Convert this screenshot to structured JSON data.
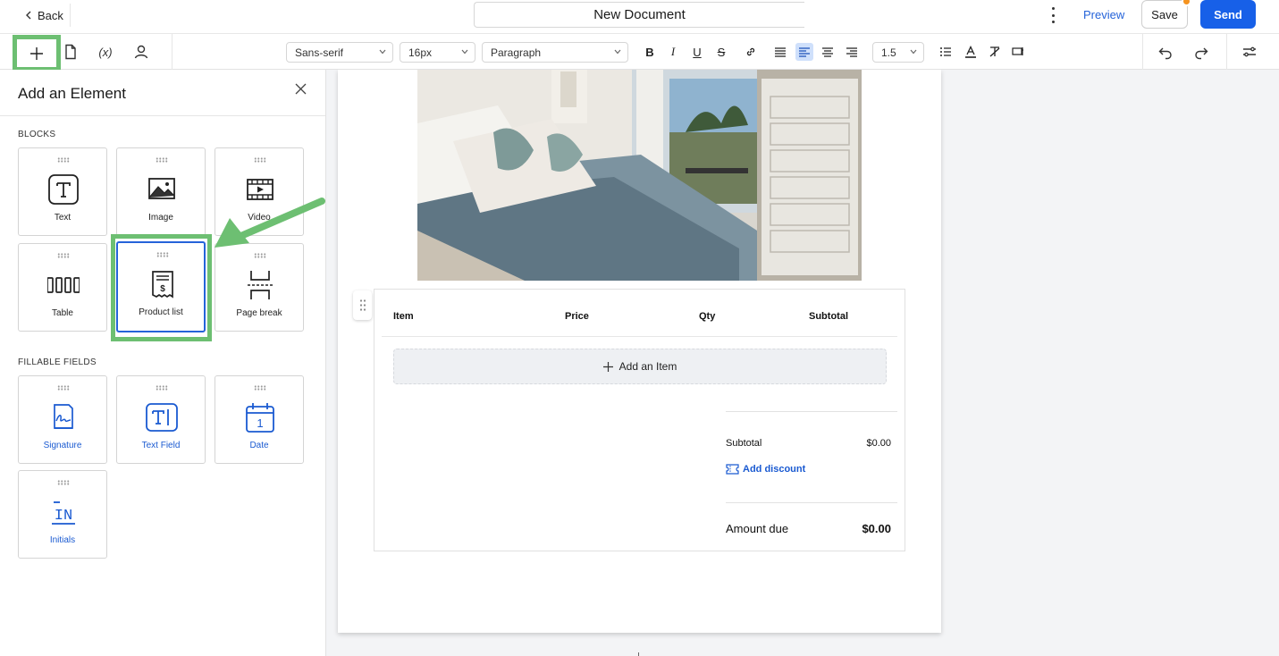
{
  "topbar": {
    "back_label": "Back",
    "document_title": "New Document",
    "preview_label": "Preview",
    "save_label": "Save",
    "send_label": "Send",
    "accent_color": "#1760e8",
    "unsaved_dot_color": "#f5931f"
  },
  "toolbar": {
    "left_icons": [
      "plus-icon",
      "document-icon",
      "variable-icon",
      "user-icon"
    ],
    "variable_glyph": "(x)",
    "font_family": "Sans-serif",
    "font_size": "16px",
    "block_style": "Paragraph",
    "line_height": "1.5",
    "format_icons": [
      "bold-icon",
      "italic-icon",
      "underline-icon",
      "strikethrough-icon",
      "link-icon",
      "align-justify-icon",
      "align-left-icon",
      "align-center-icon",
      "align-right-icon"
    ],
    "active_format": "align-left-icon",
    "bold_glyph": "B",
    "italic_glyph": "I",
    "underline_glyph": "U",
    "strike_glyph": "S"
  },
  "panel": {
    "title": "Add an Element",
    "blocks_label": "BLOCKS",
    "fillable_label": "FILLABLE FIELDS",
    "blocks": [
      {
        "label": "Text",
        "icon": "text-block-icon"
      },
      {
        "label": "Image",
        "icon": "image-icon"
      },
      {
        "label": "Video",
        "icon": "video-icon"
      },
      {
        "label": "Table",
        "icon": "table-icon"
      },
      {
        "label": "Product list",
        "icon": "product-list-icon"
      },
      {
        "label": "Page break",
        "icon": "page-break-icon"
      }
    ],
    "fillable_fields": [
      {
        "label": "Signature",
        "icon": "signature-icon"
      },
      {
        "label": "Text Field",
        "icon": "text-field-icon"
      },
      {
        "label": "Date",
        "icon": "calendar-icon",
        "glyph": "1"
      },
      {
        "label": "Initials",
        "icon": "initials-icon",
        "glyph": "IN"
      }
    ],
    "selected_block": "Product list",
    "annotation_color": "#6dbf72"
  },
  "product_list": {
    "columns": [
      "Item",
      "Price",
      "Qty",
      "Subtotal"
    ],
    "add_item_label": "Add an Item",
    "subtotal_label": "Subtotal",
    "subtotal_value": "$0.00",
    "discount_label": "Add discount",
    "amount_due_label": "Amount due",
    "amount_due_value": "$0.00"
  }
}
